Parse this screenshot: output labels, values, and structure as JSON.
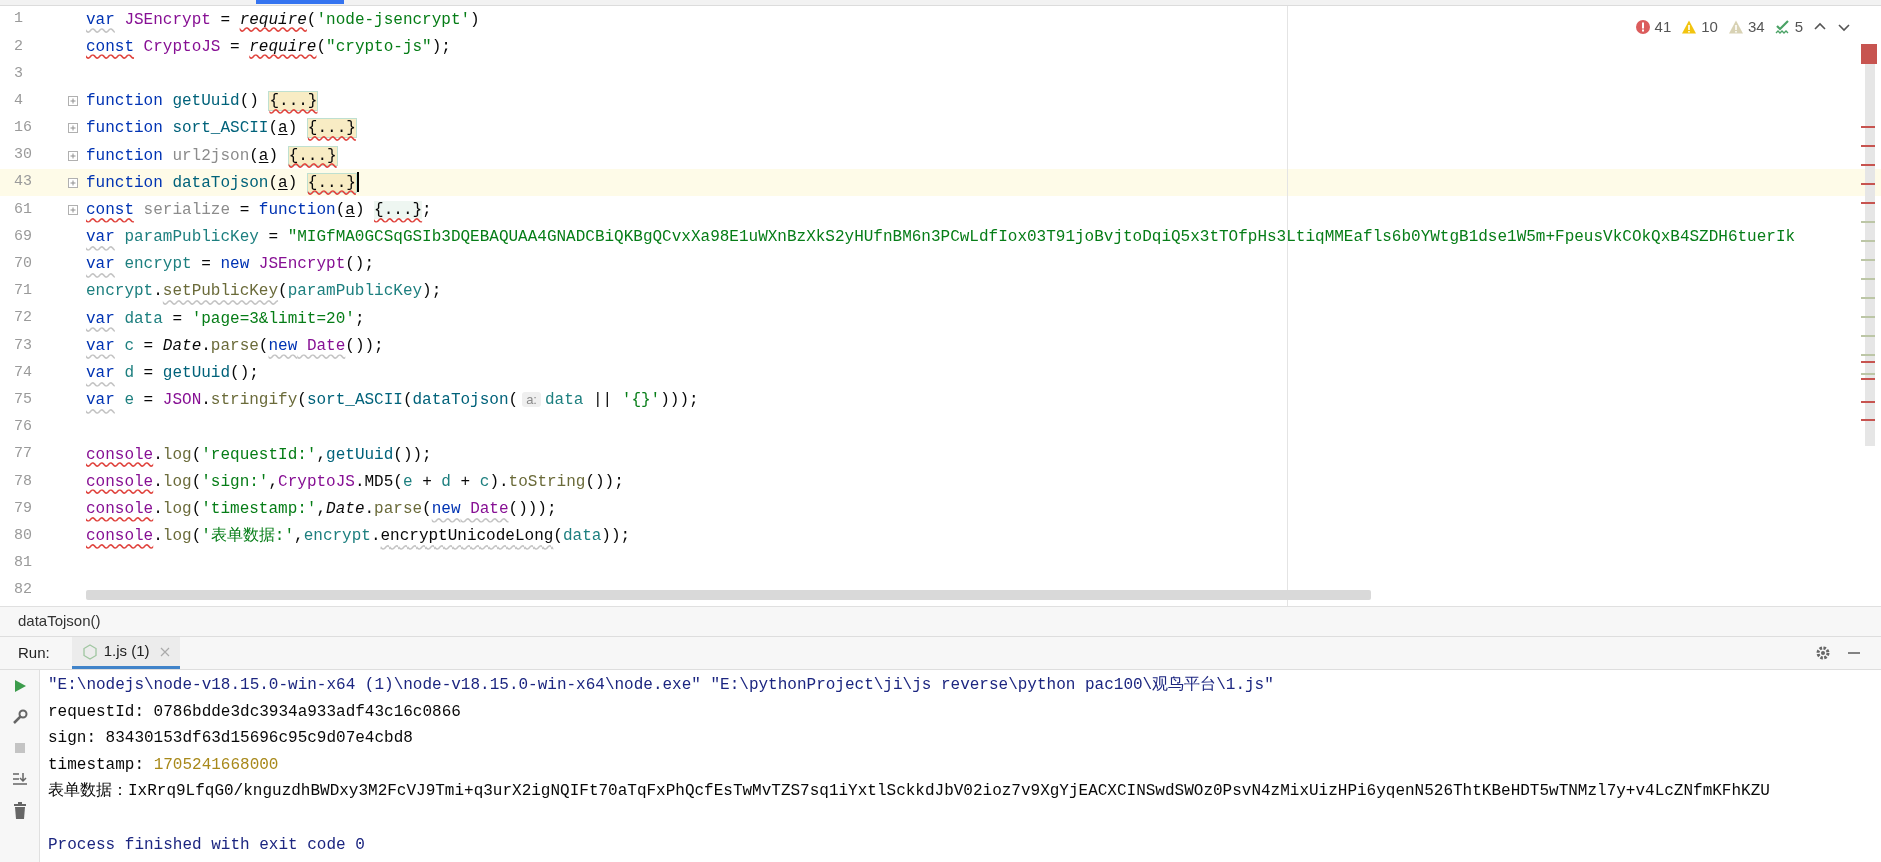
{
  "problems": [
    {
      "kind": "error",
      "count": "41"
    },
    {
      "kind": "warning",
      "count": "10"
    },
    {
      "kind": "weak",
      "count": "34"
    },
    {
      "kind": "typo",
      "count": "5"
    }
  ],
  "editor": {
    "lines": [
      {
        "number": "1",
        "foldable": false,
        "current": false,
        "tokens": [
          {
            "text": "var",
            "kind": "keyword",
            "weak": true
          },
          {
            "text": " JSEncrypt",
            "kind": "global"
          },
          {
            "text": " = "
          },
          {
            "text": "require",
            "kind": "plain",
            "italic": true,
            "error": true
          },
          {
            "text": "("
          },
          {
            "text": "'node-jsencrypt'",
            "kind": "string"
          },
          {
            "text": ")"
          }
        ]
      },
      {
        "number": "2",
        "foldable": false,
        "current": false,
        "tokens": [
          {
            "text": "const",
            "kind": "keyword",
            "error": true
          },
          {
            "text": " CryptoJS",
            "kind": "global"
          },
          {
            "text": " = "
          },
          {
            "text": "require",
            "kind": "plain",
            "italic": true,
            "error": true
          },
          {
            "text": "("
          },
          {
            "text": "\"crypto-js\"",
            "kind": "string"
          },
          {
            "text": ");"
          }
        ]
      },
      {
        "number": "3",
        "foldable": false,
        "current": false
      },
      {
        "number": "4",
        "foldable": true,
        "current": false,
        "tokens": [
          {
            "text": "function",
            "kind": "keyword"
          },
          {
            "text": " getUuid",
            "kind": "function"
          },
          {
            "text": "() "
          },
          {
            "text": "{...}",
            "kind": "fold",
            "error": true
          }
        ]
      },
      {
        "number": "16",
        "foldable": true,
        "current": false,
        "tokens": [
          {
            "text": "function",
            "kind": "keyword"
          },
          {
            "text": " sort_ASCII",
            "kind": "function"
          },
          {
            "text": "("
          },
          {
            "text": "a",
            "kind": "param"
          },
          {
            "text": ") "
          },
          {
            "text": "{...}",
            "kind": "fold",
            "error": true
          }
        ]
      },
      {
        "number": "30",
        "foldable": true,
        "current": false,
        "tokens": [
          {
            "text": "function",
            "kind": "keyword"
          },
          {
            "text": " url2json",
            "kind": "unused"
          },
          {
            "text": "("
          },
          {
            "text": "a",
            "kind": "param"
          },
          {
            "text": ") "
          },
          {
            "text": "{...}",
            "kind": "fold",
            "error": true
          }
        ]
      },
      {
        "number": "43",
        "foldable": true,
        "current": true,
        "tokens": [
          {
            "text": "function",
            "kind": "keyword"
          },
          {
            "text": " dataTojson",
            "kind": "function"
          },
          {
            "text": "("
          },
          {
            "text": "a",
            "kind": "param"
          },
          {
            "text": ") "
          },
          {
            "text": "{...}",
            "kind": "fold",
            "error": true
          }
        ]
      },
      {
        "number": "61",
        "foldable": true,
        "current": false,
        "tokens": [
          {
            "text": "const",
            "kind": "keyword",
            "error": true
          },
          {
            "text": " serialize",
            "kind": "unused"
          },
          {
            "text": " = "
          },
          {
            "text": "function",
            "kind": "keyword"
          },
          {
            "text": "("
          },
          {
            "text": "a",
            "kind": "param"
          },
          {
            "text": ") "
          },
          {
            "text": "{...}",
            "kind": "fold-light",
            "error": true
          },
          {
            "text": ";"
          }
        ]
      },
      {
        "number": "69",
        "foldable": false,
        "current": false,
        "tokens": [
          {
            "text": "var",
            "kind": "keyword",
            "weak": true
          },
          {
            "text": " paramPublicKey",
            "kind": "local"
          },
          {
            "text": " = "
          },
          {
            "text": "\"MIGfMA0GCSqGSIb3DQEBAQUAA4GNADCBiQKBgQCvxXa98E1uWXnBzXkS2yHUfnBM6n3PCwLdfIox03T91joBvjtoDqiQ5x3tTOfpHs3LtiqMMEafls6b0YWtgB1dse1W5m+FpeusVkCOkQxB4SZDH6tuerIk",
            "kind": "string"
          }
        ]
      },
      {
        "number": "70",
        "foldable": false,
        "current": false,
        "tokens": [
          {
            "text": "var",
            "kind": "keyword",
            "weak": true
          },
          {
            "text": " encrypt",
            "kind": "local"
          },
          {
            "text": " = "
          },
          {
            "text": "new",
            "kind": "keyword"
          },
          {
            "text": " JSEncrypt",
            "kind": "global"
          },
          {
            "text": "();"
          }
        ]
      },
      {
        "number": "71",
        "foldable": false,
        "current": false,
        "tokens": [
          {
            "text": "encrypt",
            "kind": "local"
          },
          {
            "text": "."
          },
          {
            "text": "setPublicKey",
            "kind": "method",
            "weak": true
          },
          {
            "text": "("
          },
          {
            "text": "paramPublicKey",
            "kind": "local"
          },
          {
            "text": ");"
          }
        ]
      },
      {
        "number": "72",
        "foldable": false,
        "current": false,
        "tokens": [
          {
            "text": "var",
            "kind": "keyword",
            "weak": true
          },
          {
            "text": " data",
            "kind": "local"
          },
          {
            "text": " = "
          },
          {
            "text": "'page=3&limit=20'",
            "kind": "string"
          },
          {
            "text": ";"
          }
        ]
      },
      {
        "number": "73",
        "foldable": false,
        "current": false,
        "tokens": [
          {
            "text": "var",
            "kind": "keyword",
            "weak": true
          },
          {
            "text": " c",
            "kind": "local"
          },
          {
            "text": " = "
          },
          {
            "text": "Date",
            "kind": "plain",
            "italic": true
          },
          {
            "text": "."
          },
          {
            "text": "parse",
            "kind": "method"
          },
          {
            "text": "("
          },
          {
            "text": "new",
            "kind": "keyword",
            "weak": true
          },
          {
            "text": " Date",
            "kind": "global",
            "weak": true
          },
          {
            "text": "());"
          }
        ]
      },
      {
        "number": "74",
        "foldable": false,
        "current": false,
        "tokens": [
          {
            "text": "var",
            "kind": "keyword",
            "weak": true
          },
          {
            "text": " d",
            "kind": "local"
          },
          {
            "text": " = "
          },
          {
            "text": "getUuid",
            "kind": "function"
          },
          {
            "text": "();"
          }
        ]
      },
      {
        "number": "75",
        "foldable": false,
        "current": false,
        "tokens": [
          {
            "text": "var",
            "kind": "keyword",
            "weak": true
          },
          {
            "text": " e",
            "kind": "local"
          },
          {
            "text": " = "
          },
          {
            "text": "JSON",
            "kind": "global"
          },
          {
            "text": "."
          },
          {
            "text": "stringify",
            "kind": "method"
          },
          {
            "text": "("
          },
          {
            "text": "sort_ASCII",
            "kind": "function"
          },
          {
            "text": "("
          },
          {
            "text": "dataTojson",
            "kind": "function"
          },
          {
            "text": "("
          },
          {
            "text": "a:",
            "kind": "hint"
          },
          {
            "text": "data",
            "kind": "local"
          },
          {
            "text": " || "
          },
          {
            "text": "'{}'",
            "kind": "string"
          },
          {
            "text": ")));"
          }
        ]
      },
      {
        "number": "76",
        "foldable": false,
        "current": false
      },
      {
        "number": "77",
        "foldable": false,
        "current": false,
        "tokens": [
          {
            "text": "console",
            "kind": "global",
            "error": true
          },
          {
            "text": "."
          },
          {
            "text": "log",
            "kind": "method"
          },
          {
            "text": "("
          },
          {
            "text": "'requestId:'",
            "kind": "string"
          },
          {
            "text": ","
          },
          {
            "text": "getUuid",
            "kind": "function"
          },
          {
            "text": "());"
          }
        ]
      },
      {
        "number": "78",
        "foldable": false,
        "current": false,
        "tokens": [
          {
            "text": "console",
            "kind": "global",
            "error": true
          },
          {
            "text": "."
          },
          {
            "text": "log",
            "kind": "method"
          },
          {
            "text": "("
          },
          {
            "text": "'sign:'",
            "kind": "string"
          },
          {
            "text": ","
          },
          {
            "text": "CryptoJS",
            "kind": "global"
          },
          {
            "text": "."
          },
          {
            "text": "MD5",
            "kind": "plain"
          },
          {
            "text": "("
          },
          {
            "text": "e",
            "kind": "local"
          },
          {
            "text": " + "
          },
          {
            "text": "d",
            "kind": "local"
          },
          {
            "text": " + "
          },
          {
            "text": "c",
            "kind": "local"
          },
          {
            "text": ")."
          },
          {
            "text": "toString",
            "kind": "method"
          },
          {
            "text": "());"
          }
        ]
      },
      {
        "number": "79",
        "foldable": false,
        "current": false,
        "tokens": [
          {
            "text": "console",
            "kind": "global",
            "error": true
          },
          {
            "text": "."
          },
          {
            "text": "log",
            "kind": "method"
          },
          {
            "text": "("
          },
          {
            "text": "'timestamp:'",
            "kind": "string"
          },
          {
            "text": ","
          },
          {
            "text": "Date",
            "kind": "plain",
            "italic": true
          },
          {
            "text": "."
          },
          {
            "text": "parse",
            "kind": "method"
          },
          {
            "text": "("
          },
          {
            "text": "new",
            "kind": "keyword",
            "weak": true
          },
          {
            "text": " Date",
            "kind": "global",
            "weak": true
          },
          {
            "text": "()));"
          }
        ]
      },
      {
        "number": "80",
        "foldable": false,
        "current": false,
        "tokens": [
          {
            "text": "console",
            "kind": "global",
            "error": true
          },
          {
            "text": "."
          },
          {
            "text": "log",
            "kind": "method"
          },
          {
            "text": "("
          },
          {
            "text": "'表单数据:'",
            "kind": "string"
          },
          {
            "text": ","
          },
          {
            "text": "encrypt",
            "kind": "local"
          },
          {
            "text": "."
          },
          {
            "text": "encryptUnicodeLong",
            "kind": "plain",
            "weak": true
          },
          {
            "text": "("
          },
          {
            "text": "data",
            "kind": "local"
          },
          {
            "text": "));"
          }
        ]
      },
      {
        "number": "81",
        "foldable": false,
        "current": false
      },
      {
        "number": "82",
        "foldable": false,
        "current": false
      }
    ]
  },
  "breadcrumb": "dataTojson()",
  "run": {
    "label": "Run:",
    "tabs": [
      {
        "label": "1.js (1)",
        "selected": true
      }
    ],
    "output": [
      [
        {
          "text": "\"E:\\nodejs\\node-v18.15.0-win-x64 (1)\\node-v18.15.0-win-x64\\node.exe\" \"E:\\pythonProject\\ji\\js reverse\\python pac100\\观鸟平台\\1.js\"",
          "kind": "system"
        }
      ],
      [
        {
          "text": "requestId: 0786bdde3dc3934a933adf43c16c0866",
          "kind": "plain"
        }
      ],
      [
        {
          "text": "sign: 83430153df63d15696c95c9d07e4cbd8",
          "kind": "plain"
        }
      ],
      [
        {
          "text": "timestamp: ",
          "kind": "plain"
        },
        {
          "text": "1705241668000",
          "kind": "number"
        }
      ],
      [
        {
          "text": "表单数据：IxRrq9LfqG0/knguzdhBWDxy3M2FcVJ9Tmi+q3urX2igNQIFt70aTqFxPhQcfEsTwMvTZS7sq1iYxtlSckkdJbV02ioz7v9XgYjEACXCINSwdSWOz0PsvN4zMixUizHPi6yqenN526ThtKBeHDT5wTNMzl7y+v4LcZNfmKFhKZU",
          "kind": "plain"
        }
      ],
      [
        {
          "text": "Process finished with exit code 0",
          "kind": "system",
          "gap_before": true
        }
      ]
    ]
  }
}
